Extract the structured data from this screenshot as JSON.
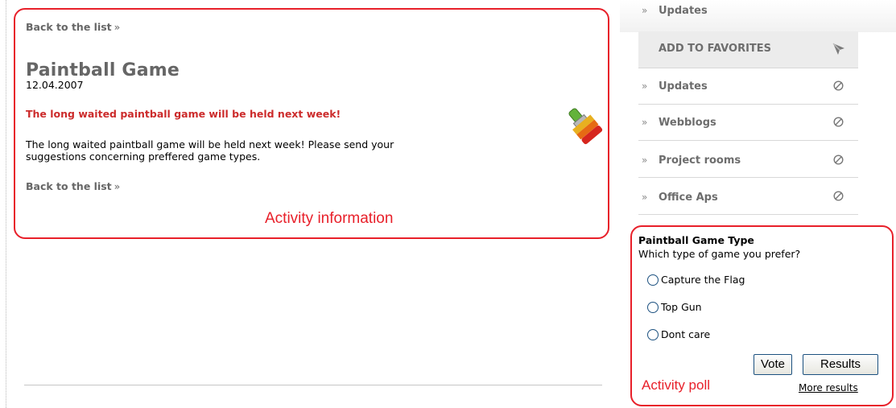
{
  "activity": {
    "back_link": "Back to the list",
    "raquo": "»",
    "title": "Paintball Game",
    "date": "12.04.2007",
    "headline": "The long waited paintball game will be held next week!",
    "body_line1": "The long waited paintball game will be held next week! Please send your",
    "body_line2": "suggestions concerning preffered game types.",
    "annotation": "Activity information"
  },
  "sidebar": {
    "top_item": "Updates",
    "favorites": "ADD TO FAVORITES",
    "items": [
      {
        "label": "Updates"
      },
      {
        "label": "Webblogs"
      },
      {
        "label": "Project rooms"
      },
      {
        "label": "Office Aps"
      }
    ],
    "raquo": "»"
  },
  "poll": {
    "title": "Paintball Game Type",
    "question": "Which type of game you prefer?",
    "options": [
      "Capture the Flag",
      "Top Gun",
      "Dont care"
    ],
    "vote_label": "Vote",
    "results_label": "Results",
    "more_results": "More results",
    "annotation": "Activity poll"
  },
  "colors": {
    "annotation_red": "#e8202a",
    "headline_red": "#cc2b2b",
    "muted_gray": "#6d6d6d"
  }
}
